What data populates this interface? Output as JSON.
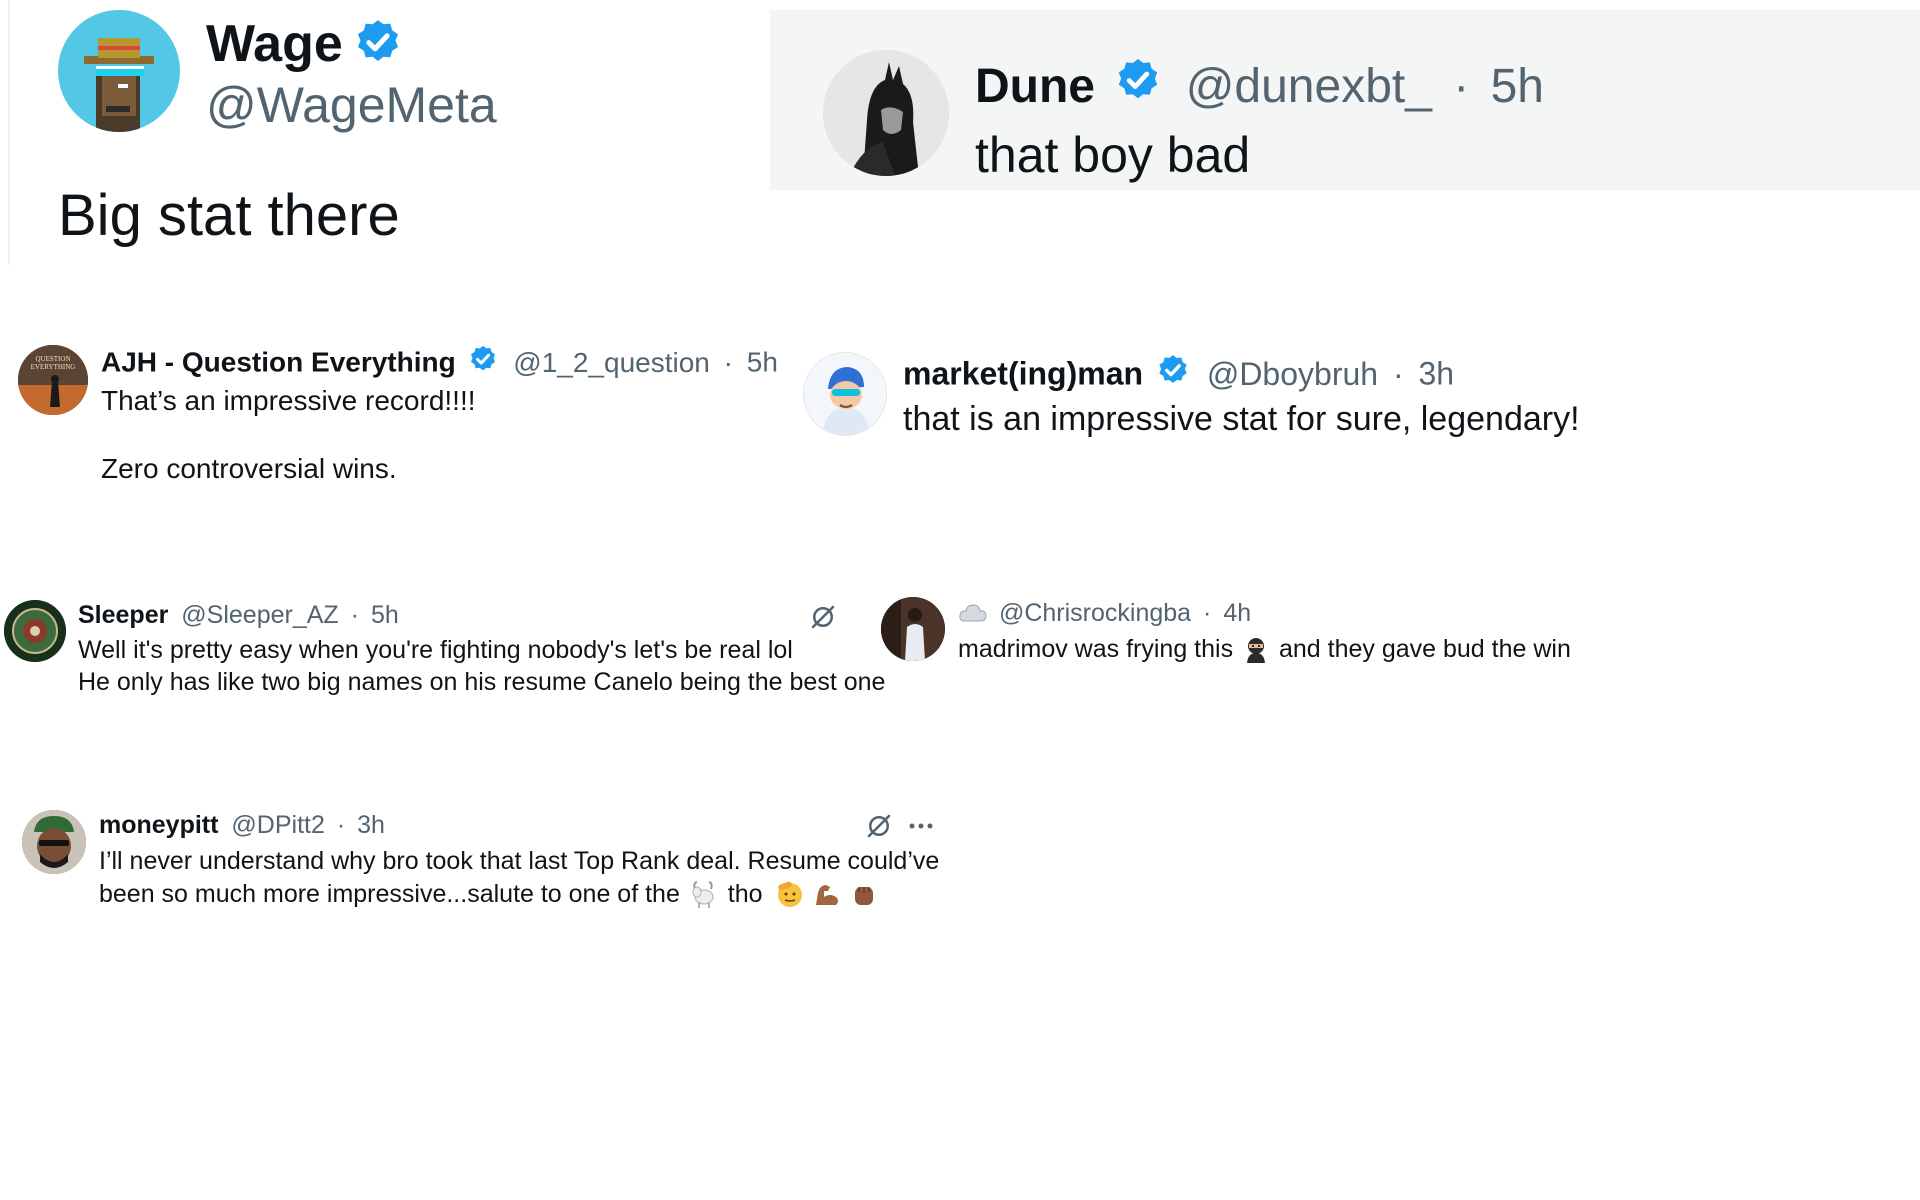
{
  "colors": {
    "verified": "#1d9bf0",
    "text": "#0f1419",
    "muted": "#536471",
    "card_bg": "#f4f5f5"
  },
  "main_tweet": {
    "name": "Wage",
    "handle": "@WageMeta",
    "text": "Big stat there",
    "verified": true
  },
  "replies": [
    {
      "name": "Dune",
      "handle": "@dunexbt_",
      "time": "5h",
      "text": "that boy bad",
      "verified": true
    },
    {
      "name": "AJH - Question Everything",
      "handle": "@1_2_question",
      "time": "5h",
      "text": "That’s an impressive record!!!!\n\nZero controversial wins.",
      "verified": true,
      "avatar_text": "QUESTION EVERYTHING"
    },
    {
      "name": "market(ing)man",
      "handle": "@Dboybruh",
      "time": "3h",
      "text": "that is an impressive stat for sure, legendary!",
      "verified": true
    },
    {
      "name": "Sleeper",
      "handle": "@Sleeper_AZ",
      "time": "5h",
      "line1": "Well it's pretty easy when you're fighting nobody's let's be real lol",
      "line2": "He only has like two big names on his resume Canelo being the best one",
      "verified": false
    },
    {
      "name": "",
      "handle": "@Chrisrockingba",
      "time": "4h",
      "text_before": "madrimov was frying this",
      "text_after": "and they gave bud the win",
      "verified": false,
      "name_icon": "cloud-emoji",
      "inline_icon": "ninja-emoji"
    },
    {
      "name": "moneypitt",
      "handle": "@DPitt2",
      "time": "3h",
      "line1": "I’ll never understand why bro took that last Top Rank deal. Resume could’ve",
      "line2_before": "been so much more impressive...salute to one of the",
      "line2_after": "tho",
      "verified": false,
      "inline_icons": [
        "goat-emoji",
        "saluting-face-emoji",
        "flexed-biceps-emoji",
        "raised-fist-emoji"
      ]
    }
  ],
  "separators": {
    "dot": "·"
  }
}
